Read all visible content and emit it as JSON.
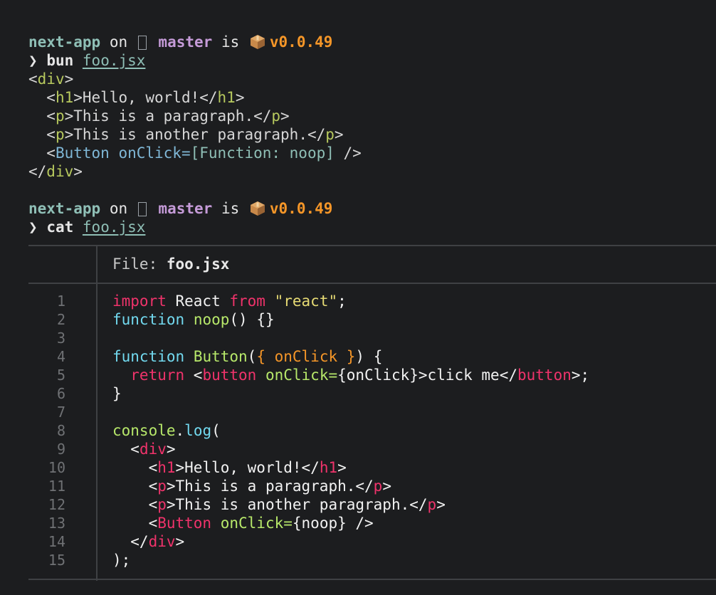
{
  "prompt": {
    "dir": "next-app",
    "on": "on",
    "branch": "master",
    "is": "is",
    "version": "v0.0.49",
    "arrow": "❯"
  },
  "cmd1": {
    "name": "bun",
    "arg": "foo.jsx"
  },
  "output": {
    "l1_open": "<",
    "l1_tag": "div",
    "l1_close": ">",
    "l2_a": "  <",
    "l2_tag": "h1",
    "l2_b": ">Hello, world!</",
    "l2_tag2": "h1",
    "l2_c": ">",
    "l3_a": "  <",
    "l3_tag": "p",
    "l3_b": ">This is a paragraph.</",
    "l3_tag2": "p",
    "l3_c": ">",
    "l4_a": "  <",
    "l4_tag": "p",
    "l4_b": ">This is another paragraph.</",
    "l4_tag2": "p",
    "l4_c": ">",
    "l5_a": "  <",
    "l5_tag": "Button",
    "l5_attr": " onClick=",
    "l5_val": "[Function: noop]",
    "l5_c": " />",
    "l6_a": "</",
    "l6_tag": "div",
    "l6_c": ">"
  },
  "cmd2": {
    "name": "cat",
    "arg": "foo.jsx"
  },
  "file": {
    "label": "File: ",
    "name": "foo.jsx"
  },
  "line_numbers": [
    "1",
    "2",
    "3",
    "4",
    "5",
    "6",
    "7",
    "8",
    "9",
    "10",
    "11",
    "12",
    "13",
    "14",
    "15"
  ],
  "code": {
    "c1_kw": "import",
    "c1_a": " React ",
    "c1_kw2": "from",
    "c1_sp": " ",
    "c1_str": "\"react\"",
    "c1_end": ";",
    "c2_kw": "function",
    "c2_sp": " ",
    "c2_fn": "noop",
    "c2_end": "() {}",
    "c4_kw": "function",
    "c4_sp": " ",
    "c4_fn": "Button",
    "c4_a": "(",
    "c4_b": "{ onClick }",
    "c4_end": ") {",
    "c5_kw": "  return",
    "c5_a": " <",
    "c5_tag": "button",
    "c5_sp": " ",
    "c5_attr": "onClick=",
    "c5_b": "{onClick}>click me</",
    "c5_tag2": "button",
    "c5_end": ">;",
    "c6": "}",
    "c8_obj": "console",
    "c8_dot": ".",
    "c8_m": "log",
    "c8_end": "(",
    "c9_a": "  <",
    "c9_tag": "div",
    "c9_end": ">",
    "c10_a": "    <",
    "c10_tag": "h1",
    "c10_b": ">Hello, world!</",
    "c10_tag2": "h1",
    "c10_end": ">",
    "c11_a": "    <",
    "c11_tag": "p",
    "c11_b": ">This is a paragraph.</",
    "c11_tag2": "p",
    "c11_end": ">",
    "c12_a": "    <",
    "c12_tag": "p",
    "c12_b": ">This is another paragraph.</",
    "c12_tag2": "p",
    "c12_end": ">",
    "c13_a": "    <",
    "c13_tag": "Button",
    "c13_sp": " ",
    "c13_attr": "onClick=",
    "c13_b": "{noop} />",
    "c14_a": "  </",
    "c14_tag": "div",
    "c14_end": ">",
    "c15": ");"
  }
}
